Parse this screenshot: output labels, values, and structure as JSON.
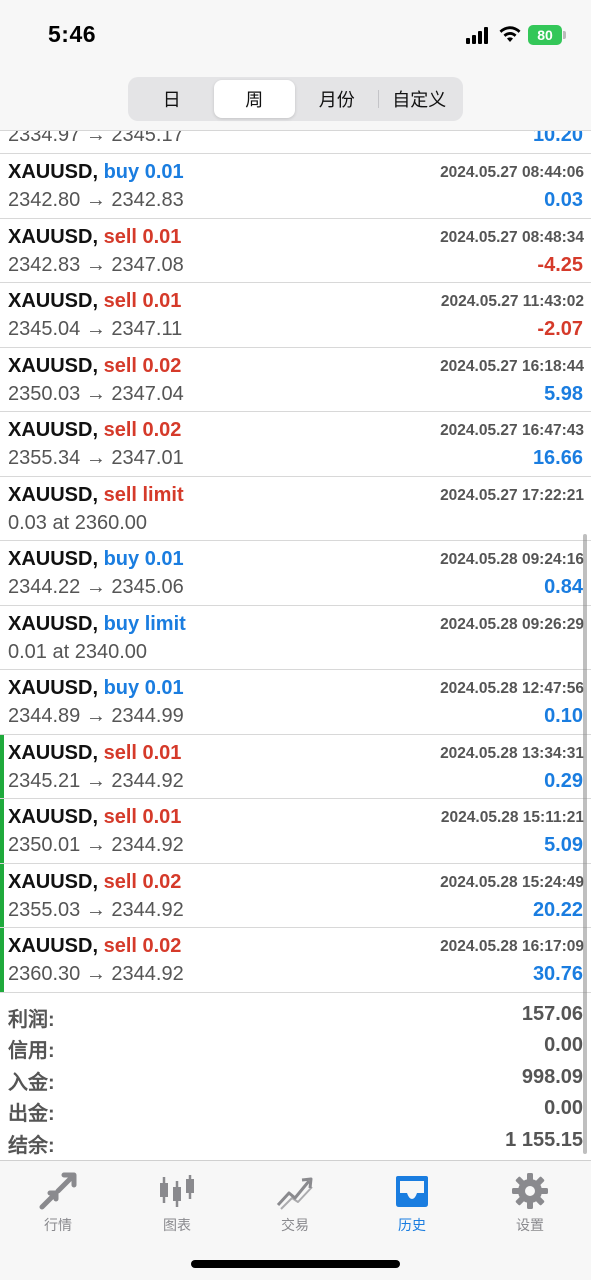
{
  "status_bar": {
    "time": "5:46",
    "battery": "80"
  },
  "period_tabs": [
    {
      "label": "日",
      "active": false
    },
    {
      "label": "周",
      "active": true
    },
    {
      "label": "月份",
      "active": false
    },
    {
      "label": "自定义",
      "active": false
    }
  ],
  "partial_row": {
    "prices": "2334.97 → 2345.17",
    "profit": "10.20"
  },
  "orders": [
    {
      "symbol": "XAUUSD,",
      "side": "buy 0.01",
      "side_type": "buy",
      "time": "2024.05.27 08:44:06",
      "prices": "2342.80 → 2342.83",
      "profit": "0.03",
      "profit_sign": "pos",
      "marker": false
    },
    {
      "symbol": "XAUUSD,",
      "side": "sell 0.01",
      "side_type": "sell",
      "time": "2024.05.27 08:48:34",
      "prices": "2342.83 → 2347.08",
      "profit": "-4.25",
      "profit_sign": "neg",
      "marker": false
    },
    {
      "symbol": "XAUUSD,",
      "side": "sell 0.01",
      "side_type": "sell",
      "time": "2024.05.27 11:43:02",
      "prices": "2345.04 → 2347.11",
      "profit": "-2.07",
      "profit_sign": "neg",
      "marker": false
    },
    {
      "symbol": "XAUUSD,",
      "side": "sell 0.02",
      "side_type": "sell",
      "time": "2024.05.27 16:18:44",
      "prices": "2350.03 → 2347.04",
      "profit": "5.98",
      "profit_sign": "pos",
      "marker": false
    },
    {
      "symbol": "XAUUSD,",
      "side": "sell 0.02",
      "side_type": "sell",
      "time": "2024.05.27 16:47:43",
      "prices": "2355.34 → 2347.01",
      "profit": "16.66",
      "profit_sign": "pos",
      "marker": false
    },
    {
      "symbol": "XAUUSD,",
      "side": "sell limit",
      "side_type": "sell",
      "time": "2024.05.27 17:22:21",
      "prices": "0.03 at 2360.00",
      "profit": "",
      "profit_sign": "pos",
      "marker": false
    },
    {
      "symbol": "XAUUSD,",
      "side": "buy 0.01",
      "side_type": "buy",
      "time": "2024.05.28 09:24:16",
      "prices": "2344.22 → 2345.06",
      "profit": "0.84",
      "profit_sign": "pos",
      "marker": false
    },
    {
      "symbol": "XAUUSD,",
      "side": "buy limit",
      "side_type": "buy",
      "time": "2024.05.28 09:26:29",
      "prices": "0.01 at 2340.00",
      "profit": "",
      "profit_sign": "pos",
      "marker": false
    },
    {
      "symbol": "XAUUSD,",
      "side": "buy 0.01",
      "side_type": "buy",
      "time": "2024.05.28 12:47:56",
      "prices": "2344.89 → 2344.99",
      "profit": "0.10",
      "profit_sign": "pos",
      "marker": false
    },
    {
      "symbol": "XAUUSD,",
      "side": "sell 0.01",
      "side_type": "sell",
      "time": "2024.05.28 13:34:31",
      "prices": "2345.21 → 2344.92",
      "profit": "0.29",
      "profit_sign": "pos",
      "marker": true
    },
    {
      "symbol": "XAUUSD,",
      "side": "sell 0.01",
      "side_type": "sell",
      "time": "2024.05.28 15:11:21",
      "prices": "2350.01 → 2344.92",
      "profit": "5.09",
      "profit_sign": "pos",
      "marker": true
    },
    {
      "symbol": "XAUUSD,",
      "side": "sell 0.02",
      "side_type": "sell",
      "time": "2024.05.28 15:24:49",
      "prices": "2355.03 → 2344.92",
      "profit": "20.22",
      "profit_sign": "pos",
      "marker": true
    },
    {
      "symbol": "XAUUSD,",
      "side": "sell 0.02",
      "side_type": "sell",
      "time": "2024.05.28 16:17:09",
      "prices": "2360.30 → 2344.92",
      "profit": "30.76",
      "profit_sign": "pos",
      "marker": true
    }
  ],
  "summary": [
    {
      "label": "利润:",
      "value": "157.06"
    },
    {
      "label": "信用:",
      "value": "0.00"
    },
    {
      "label": "入金:",
      "value": "998.09"
    },
    {
      "label": "出金:",
      "value": "0.00"
    },
    {
      "label": "结余:",
      "value": "1 155.15"
    }
  ],
  "tab_bar": [
    {
      "label": "行情",
      "icon": "quotes-arrows-icon",
      "active": false
    },
    {
      "label": "图表",
      "icon": "candlestick-chart-icon",
      "active": false
    },
    {
      "label": "交易",
      "icon": "trade-trend-icon",
      "active": false
    },
    {
      "label": "历史",
      "icon": "history-inbox-icon",
      "active": true
    },
    {
      "label": "设置",
      "icon": "gear-icon",
      "active": false
    }
  ],
  "colors": {
    "buy": "#1a7de0",
    "sell": "#d53a2a",
    "marker": "#1faa3c",
    "active_tab": "#1a7de0",
    "inactive_tab": "#8a8a8e"
  }
}
